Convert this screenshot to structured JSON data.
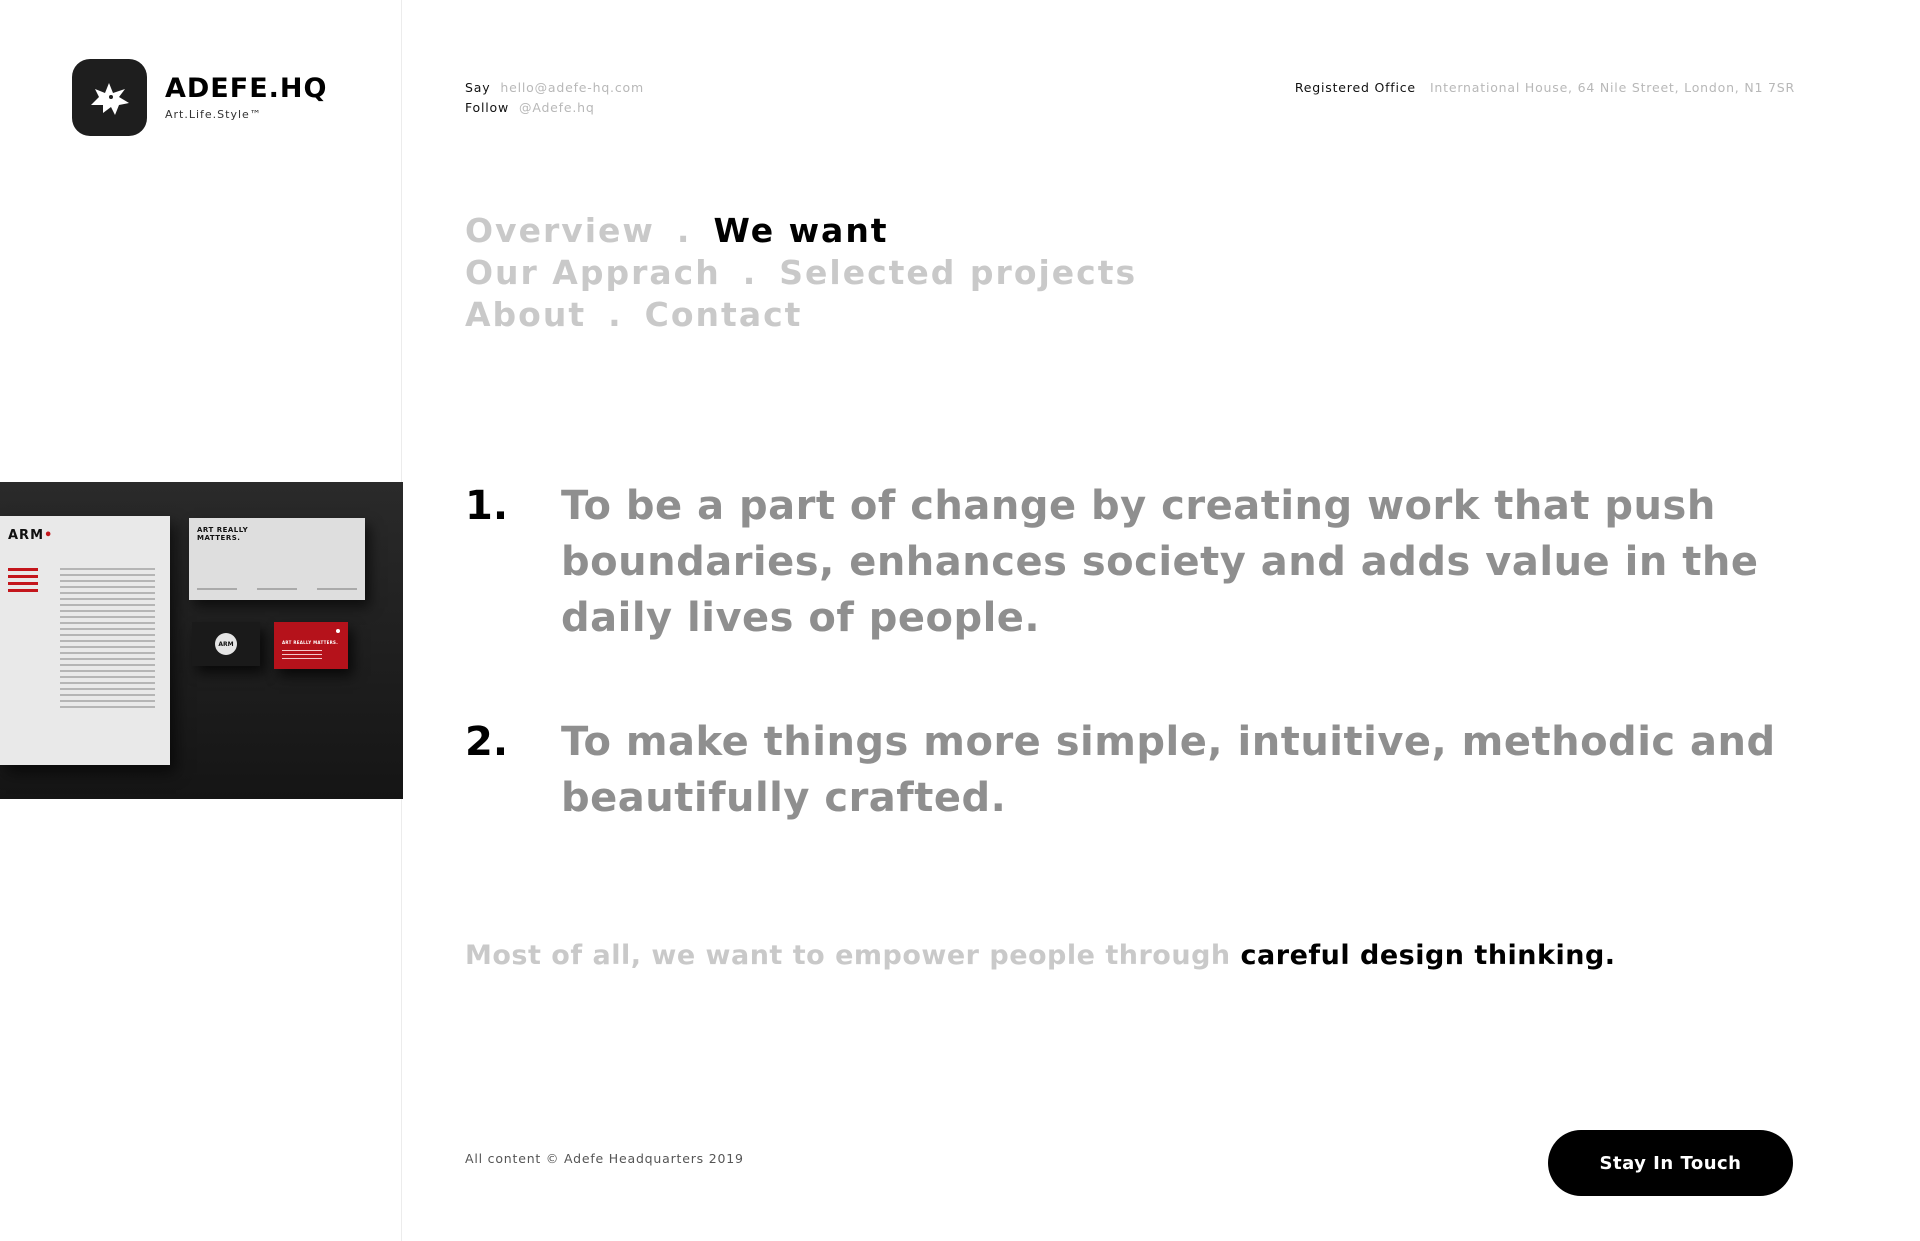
{
  "brand": {
    "name": "ADEFE.HQ",
    "tagline": "Art.Life.Style™",
    "logo_icon": "winged-horse-icon"
  },
  "contact": {
    "say_label": "Say",
    "email": "hello@adefe-hq.com",
    "follow_label": "Follow",
    "handle": "@Adefe.hq"
  },
  "office": {
    "label": "Registered Office",
    "address": "International House, 64 Nile Street, London, N1 7SR"
  },
  "nav": {
    "items": [
      "Overview",
      "We want",
      "Our Apprach",
      "Selected projects",
      "About",
      "Contact"
    ],
    "separator": ".",
    "active": "We want"
  },
  "mockup": {
    "letterhead_logo": "ARM",
    "card_title": "ART REALLY MATTERS.",
    "red_card_title": "ART REALLY MATTERS.",
    "black_card_logo": "ARM"
  },
  "goals": [
    {
      "number": "1.",
      "text": "To be a part of change by creating work that push boundaries, enhances society and adds value in the daily lives of people."
    },
    {
      "number": "2.",
      "text": "To make things more simple, intuitive, methodic and beautifully crafted."
    }
  ],
  "statement": {
    "lead": "Most of all, we want to empower people through ",
    "emphasis": "careful design thinking."
  },
  "footer": {
    "copyright": "All content © Adefe Headquarters 2019",
    "cta_label": "Stay In Touch"
  },
  "colors": {
    "accent": "#000000",
    "muted_text": "#c9c9c9",
    "body_text": "#8f8f8f",
    "brand_red": "#b5121b"
  }
}
